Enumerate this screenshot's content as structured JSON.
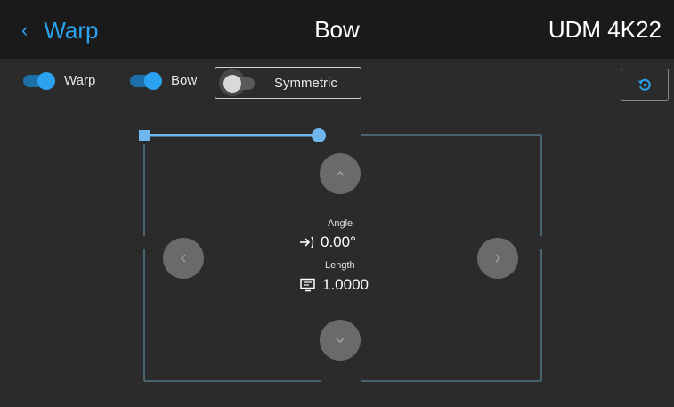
{
  "header": {
    "back_label": "Warp",
    "title": "Bow",
    "model": "UDM 4K22"
  },
  "toolbar": {
    "toggles": [
      {
        "label": "Warp",
        "state": "on"
      },
      {
        "label": "Bow",
        "state": "on"
      },
      {
        "label": "Symmetric",
        "state": "off"
      }
    ],
    "reset_icon": "reset-icon"
  },
  "editor": {
    "angle_label": "Angle",
    "angle_value": "0.00°",
    "length_label": "Length",
    "length_value": "1.0000",
    "nav_icons": [
      "chevron-up-icon",
      "chevron-left-icon",
      "chevron-right-icon",
      "chevron-down-icon"
    ]
  },
  "colors": {
    "accent": "#2aa2f0",
    "background": "#2b2b2b",
    "header_bg": "#1a1a1a",
    "frame_line": "#4a6270",
    "button": "#6a6a6a"
  }
}
